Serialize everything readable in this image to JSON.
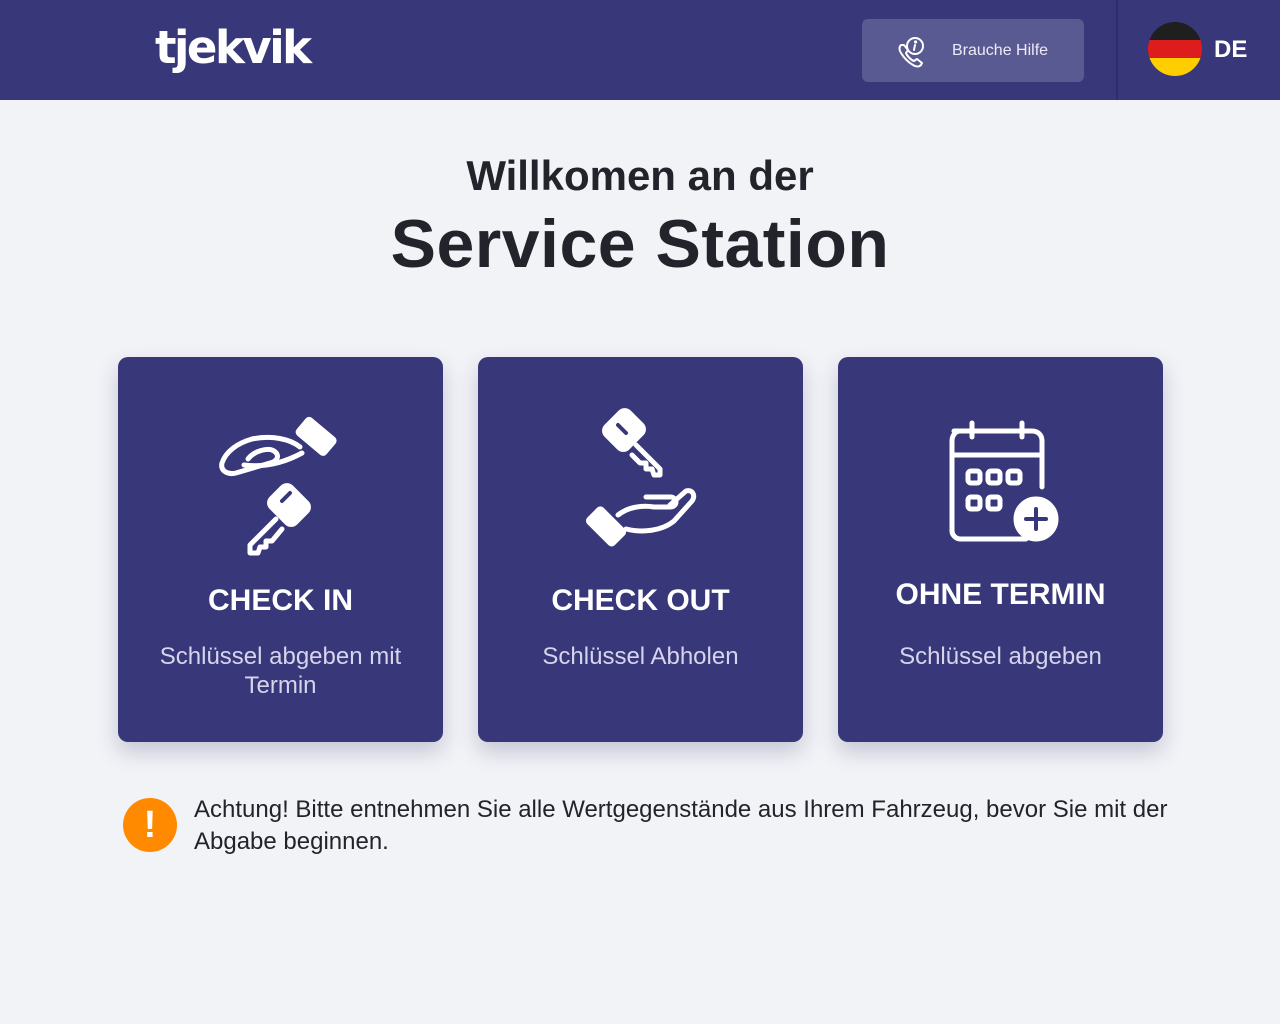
{
  "header": {
    "logo": "tjekvik",
    "help_label": "Brauche Hilfe",
    "language_code": "DE"
  },
  "welcome": {
    "line1": "Willkomen an der",
    "line2": "Service Station"
  },
  "cards": [
    {
      "title": "CHECK IN",
      "subtitle": "Schlüssel abgeben mit Termin",
      "icon": "hand-receive-key-icon"
    },
    {
      "title": "CHECK OUT",
      "subtitle": "Schlüssel Abholen",
      "icon": "key-to-hand-icon"
    },
    {
      "title": "OHNE TERMIN",
      "subtitle": "Schlüssel abgeben",
      "icon": "calendar-add-icon"
    }
  ],
  "warning": {
    "text": "Achtung! Bitte entnehmen Sie alle Wertgegenstände aus Ihrem Fahrzeug, bevor Sie mit der Abgabe beginnen.",
    "icon": "exclamation-icon"
  },
  "colors": {
    "header_bg": "#37377a",
    "card_bg": "#37377a",
    "help_button_bg": "#5a5a93",
    "warning_accent": "#ff8a00",
    "page_bg": "#f2f3f7"
  }
}
